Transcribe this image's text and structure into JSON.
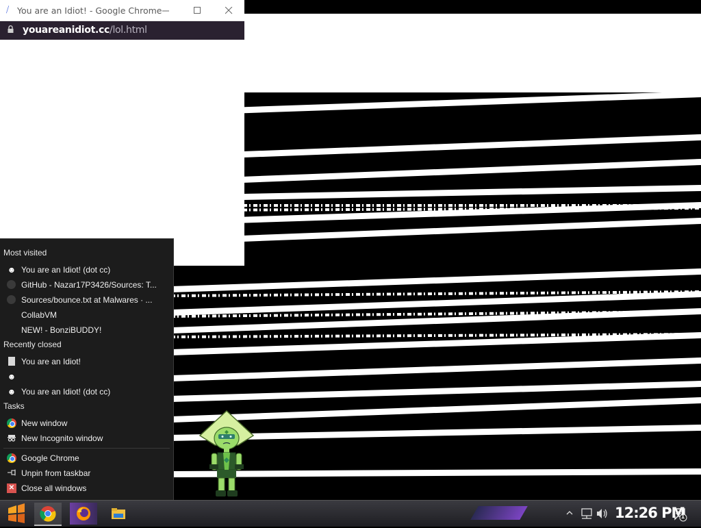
{
  "window": {
    "title": "You are an Idiot! - Google Chrome",
    "url_domain": "youareanidiot.cc",
    "url_path": "/lol.html"
  },
  "jumplist": {
    "most_visited_header": "Most visited",
    "most_visited": [
      {
        "label": "You are an Idiot! (dot cc)",
        "icon": "smiley-icon"
      },
      {
        "label": "GitHub - Nazar17P3426/Sources: T...",
        "icon": "github-icon"
      },
      {
        "label": "Sources/bounce.txt at Malwares · ...",
        "icon": "github-icon"
      },
      {
        "label": "CollabVM",
        "icon": "none"
      },
      {
        "label": "NEW! - BonziBUDDY!",
        "icon": "none"
      }
    ],
    "recently_closed_header": "Recently closed",
    "recently_closed": [
      {
        "label": "You are an Idiot!",
        "icon": "page-icon"
      },
      {
        "label": "",
        "icon": "smiley-icon"
      },
      {
        "label": "You are an Idiot! (dot cc)",
        "icon": "smiley-icon"
      }
    ],
    "tasks_header": "Tasks",
    "tasks": [
      {
        "label": "New window",
        "icon": "chrome-icon"
      },
      {
        "label": "New Incognito window",
        "icon": "incognito-icon"
      }
    ],
    "actions": [
      {
        "label": "Google Chrome",
        "icon": "chrome-icon"
      },
      {
        "label": "Unpin from taskbar",
        "icon": "unpin-icon"
      },
      {
        "label": "Close all windows",
        "icon": "close-all-icon"
      }
    ]
  },
  "taskbar": {
    "clock": "12:26 PM",
    "notification_count": "1"
  },
  "colors": {
    "jumplist_bg": "#1c1c1c",
    "addressbar_bg": "#2a2130",
    "accent_purple": "#7b44c2"
  }
}
